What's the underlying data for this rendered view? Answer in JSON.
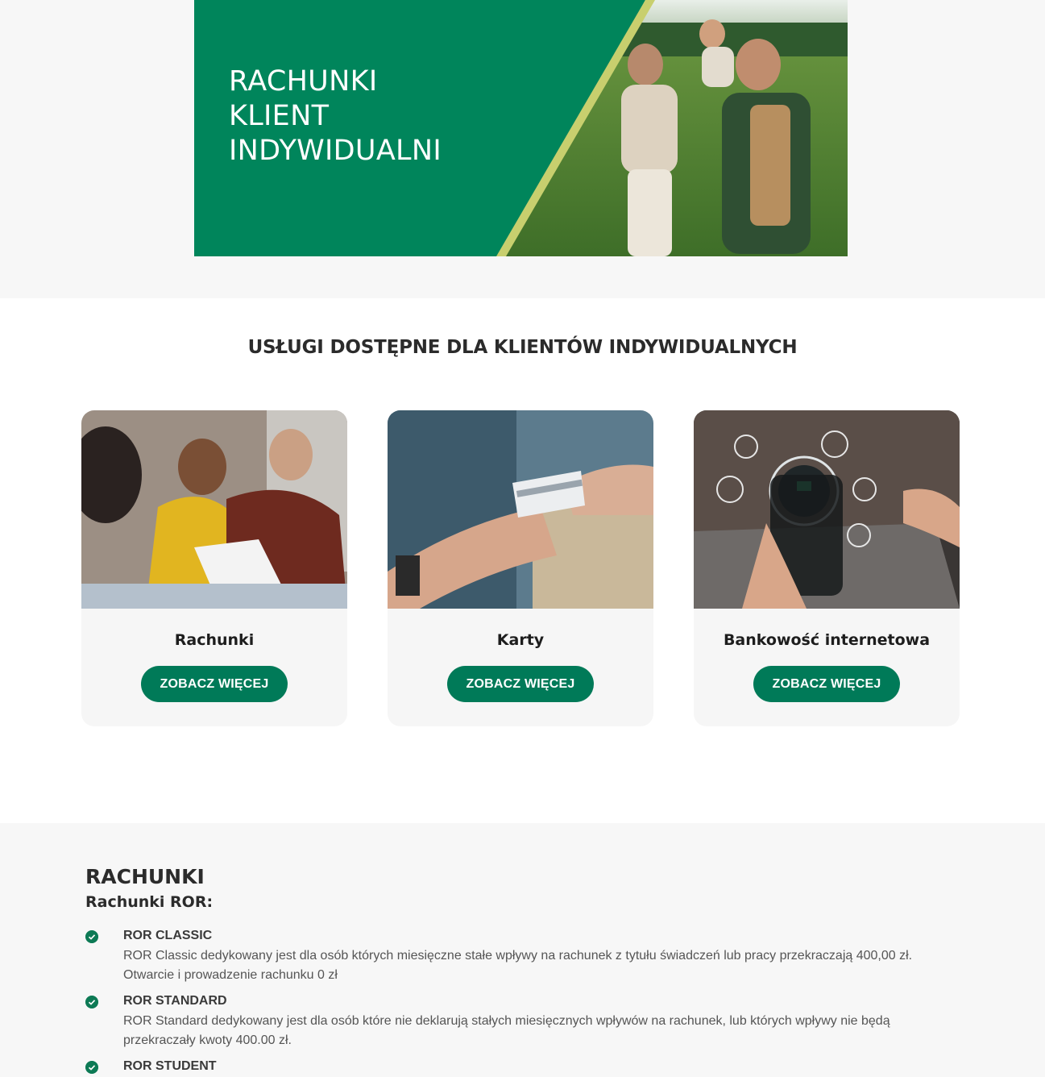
{
  "hero": {
    "title_lines": [
      "RACHUNKI",
      "KLIENT",
      "INDYWIDUALNI"
    ],
    "brand_green": "#00855b",
    "accent_stripe": "#c8cf6e"
  },
  "services": {
    "title": "USŁUGI DOSTĘPNE DLA KLIENTÓW INDYWIDUALNYCH",
    "cards": [
      {
        "name": "Rachunki",
        "button": "ZOBACZ WIĘCEJ"
      },
      {
        "name": "Karty",
        "button": "ZOBACZ WIĘCEJ"
      },
      {
        "name": "Bankowość internetowa",
        "button": "ZOBACZ WIĘCEJ"
      }
    ],
    "button_color": "#007a58"
  },
  "accounts": {
    "title": "RACHUNKI",
    "subtitle": "Rachunki ROR:",
    "items": [
      {
        "name": "ROR CLASSIC",
        "desc_1": "ROR Classic dedykowany jest dla osób których miesięczne stałe wpływy na rachunek z tytułu świadczeń lub pracy przekraczają 400,00 zł.",
        "desc_2": "Otwarcie i prowadzenie rachunku 0 zł"
      },
      {
        "name": "ROR STANDARD",
        "desc_1": "ROR Standard dedykowany jest dla osób które nie deklarują stałych miesięcznych wpływów na rachunek, lub których wpływy nie będą",
        "desc_2": "przekraczały kwoty 400.00 zł."
      },
      {
        "name": "ROR STUDENT"
      }
    ]
  }
}
